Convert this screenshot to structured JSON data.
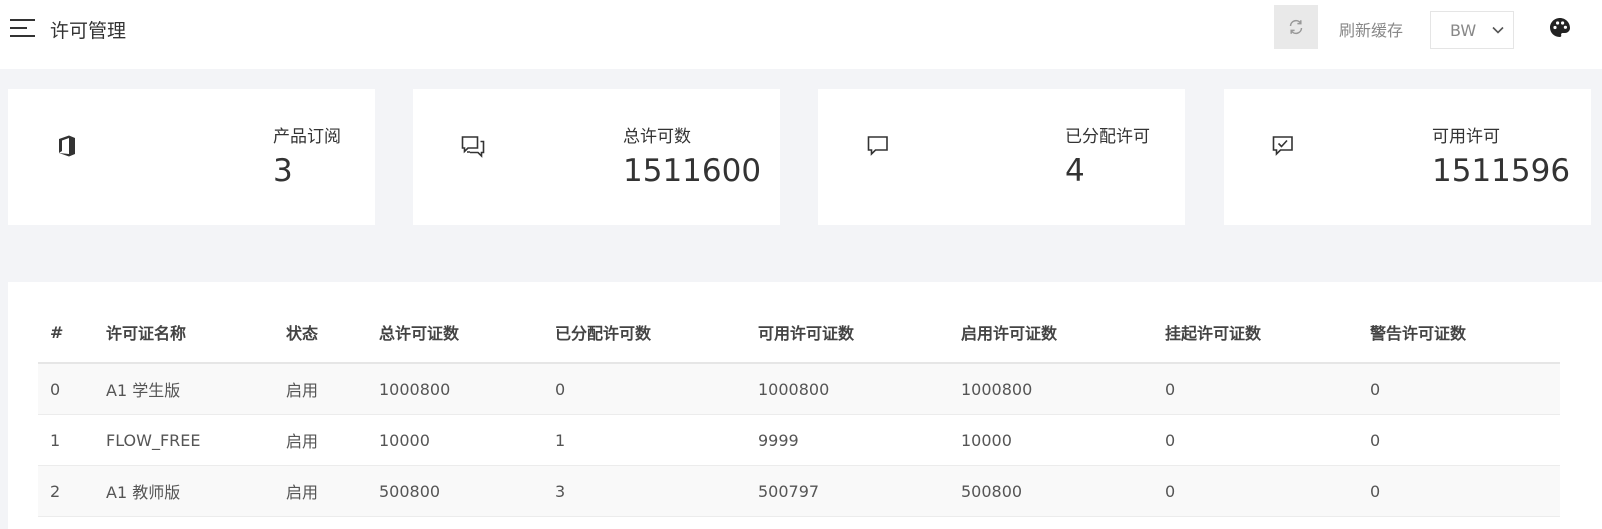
{
  "header": {
    "title": "许可管理",
    "refresh_label": "刷新缓存",
    "theme_value": "BW"
  },
  "cards": [
    {
      "label": "产品订阅",
      "value": "3",
      "icon": "office-icon"
    },
    {
      "label": "总许可数",
      "value": "1511600",
      "icon": "chat-multiple-icon"
    },
    {
      "label": "已分配许可",
      "value": "4",
      "icon": "chat-icon"
    },
    {
      "label": "可用许可",
      "value": "1511596",
      "icon": "chat-check-icon"
    }
  ],
  "table": {
    "headers": [
      "#",
      "许可证名称",
      "状态",
      "总许可证数",
      "已分配许可数",
      "可用许可证数",
      "启用许可证数",
      "挂起许可证数",
      "警告许可证数"
    ],
    "rows": [
      [
        "0",
        "A1 学生版",
        "启用",
        "1000800",
        "0",
        "1000800",
        "1000800",
        "0",
        "0"
      ],
      [
        "1",
        "FLOW_FREE",
        "启用",
        "10000",
        "1",
        "9999",
        "10000",
        "0",
        "0"
      ],
      [
        "2",
        "A1 教师版",
        "启用",
        "500800",
        "3",
        "500797",
        "500800",
        "0",
        "0"
      ]
    ]
  }
}
